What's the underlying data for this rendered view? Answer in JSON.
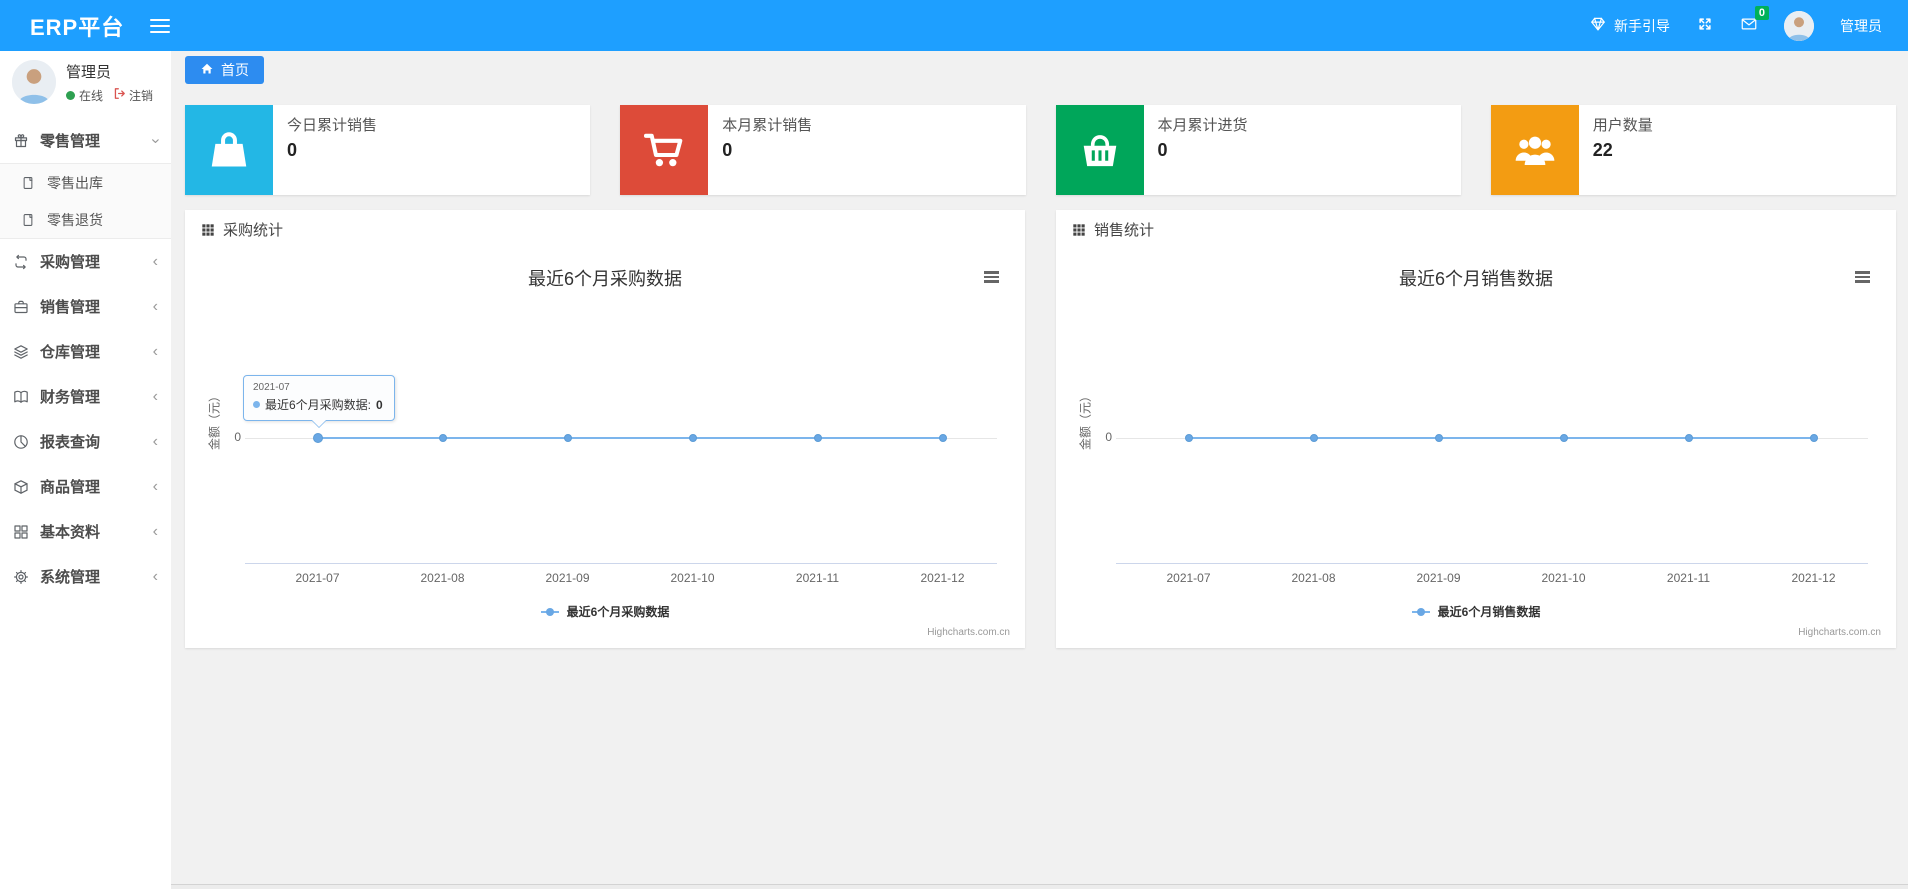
{
  "navbar": {
    "brand": "ERP平台",
    "color": "#1E9FFF",
    "guide_label": "新手引导",
    "mail_badge": "0",
    "badge_color": "#00b159",
    "username": "管理员"
  },
  "sidebar": {
    "username": "管理员",
    "status_online": "在线",
    "logout_label": "注销",
    "menu": [
      {
        "id": "retail",
        "label": "零售管理",
        "icon": "gift-icon",
        "state": "expanded",
        "children": [
          {
            "id": "retail-outbound",
            "label": "零售出库",
            "icon": "file-icon"
          },
          {
            "id": "retail-return",
            "label": "零售退货",
            "icon": "file-icon"
          }
        ]
      },
      {
        "id": "purchase",
        "label": "采购管理",
        "icon": "refresh-icon",
        "state": "collapsed"
      },
      {
        "id": "sales",
        "label": "销售管理",
        "icon": "briefcase-icon",
        "state": "collapsed"
      },
      {
        "id": "warehouse",
        "label": "仓库管理",
        "icon": "layers-icon",
        "state": "collapsed"
      },
      {
        "id": "finance",
        "label": "财务管理",
        "icon": "book-icon",
        "state": "collapsed"
      },
      {
        "id": "report",
        "label": "报表查询",
        "icon": "pie-chart-icon",
        "state": "collapsed"
      },
      {
        "id": "goods",
        "label": "商品管理",
        "icon": "box-icon",
        "state": "collapsed"
      },
      {
        "id": "basic",
        "label": "基本资料",
        "icon": "grid-icon",
        "state": "collapsed"
      },
      {
        "id": "system",
        "label": "系统管理",
        "icon": "gear-icon",
        "state": "collapsed"
      }
    ]
  },
  "breadcrumb": {
    "label": "首页"
  },
  "stat_cards": [
    {
      "label": "今日累计销售",
      "value": "0",
      "icon": "shopping-bag-icon",
      "color": "#23b7e5"
    },
    {
      "label": "本月累计销售",
      "value": "0",
      "icon": "cart-icon",
      "color": "#dd4b39"
    },
    {
      "label": "本月累计进货",
      "value": "0",
      "icon": "basket-icon",
      "color": "#00a65a"
    },
    {
      "label": "用户数量",
      "value": "22",
      "icon": "users-icon",
      "color": "#f39c12"
    }
  ],
  "panels": [
    {
      "title": "采购统计"
    },
    {
      "title": "销售统计"
    }
  ],
  "chart_data": [
    {
      "type": "line",
      "title": "最近6个月采购数据",
      "categories": [
        "2021-07",
        "2021-08",
        "2021-09",
        "2021-10",
        "2021-11",
        "2021-12"
      ],
      "series": [
        {
          "name": "最近6个月采购数据",
          "values": [
            0,
            0,
            0,
            0,
            0,
            0
          ]
        }
      ],
      "xlabel": "",
      "ylabel": "金额（元）",
      "yticks": [
        "0"
      ],
      "line_color": "#7cb5ec",
      "grid": true,
      "legend_position": "bottom",
      "credits": "Highcharts.com.cn",
      "tooltip": {
        "visible": true,
        "point_index": 0,
        "header": "2021-07",
        "label": "最近6个月采购数据: ",
        "value": "0"
      }
    },
    {
      "type": "line",
      "title": "最近6个月销售数据",
      "categories": [
        "2021-07",
        "2021-08",
        "2021-09",
        "2021-10",
        "2021-11",
        "2021-12"
      ],
      "series": [
        {
          "name": "最近6个月销售数据",
          "values": [
            0,
            0,
            0,
            0,
            0,
            0
          ]
        }
      ],
      "xlabel": "",
      "ylabel": "金额（元）",
      "yticks": [
        "0"
      ],
      "line_color": "#7cb5ec",
      "grid": true,
      "legend_position": "bottom",
      "credits": "Highcharts.com.cn",
      "tooltip": {
        "visible": false
      }
    }
  ]
}
